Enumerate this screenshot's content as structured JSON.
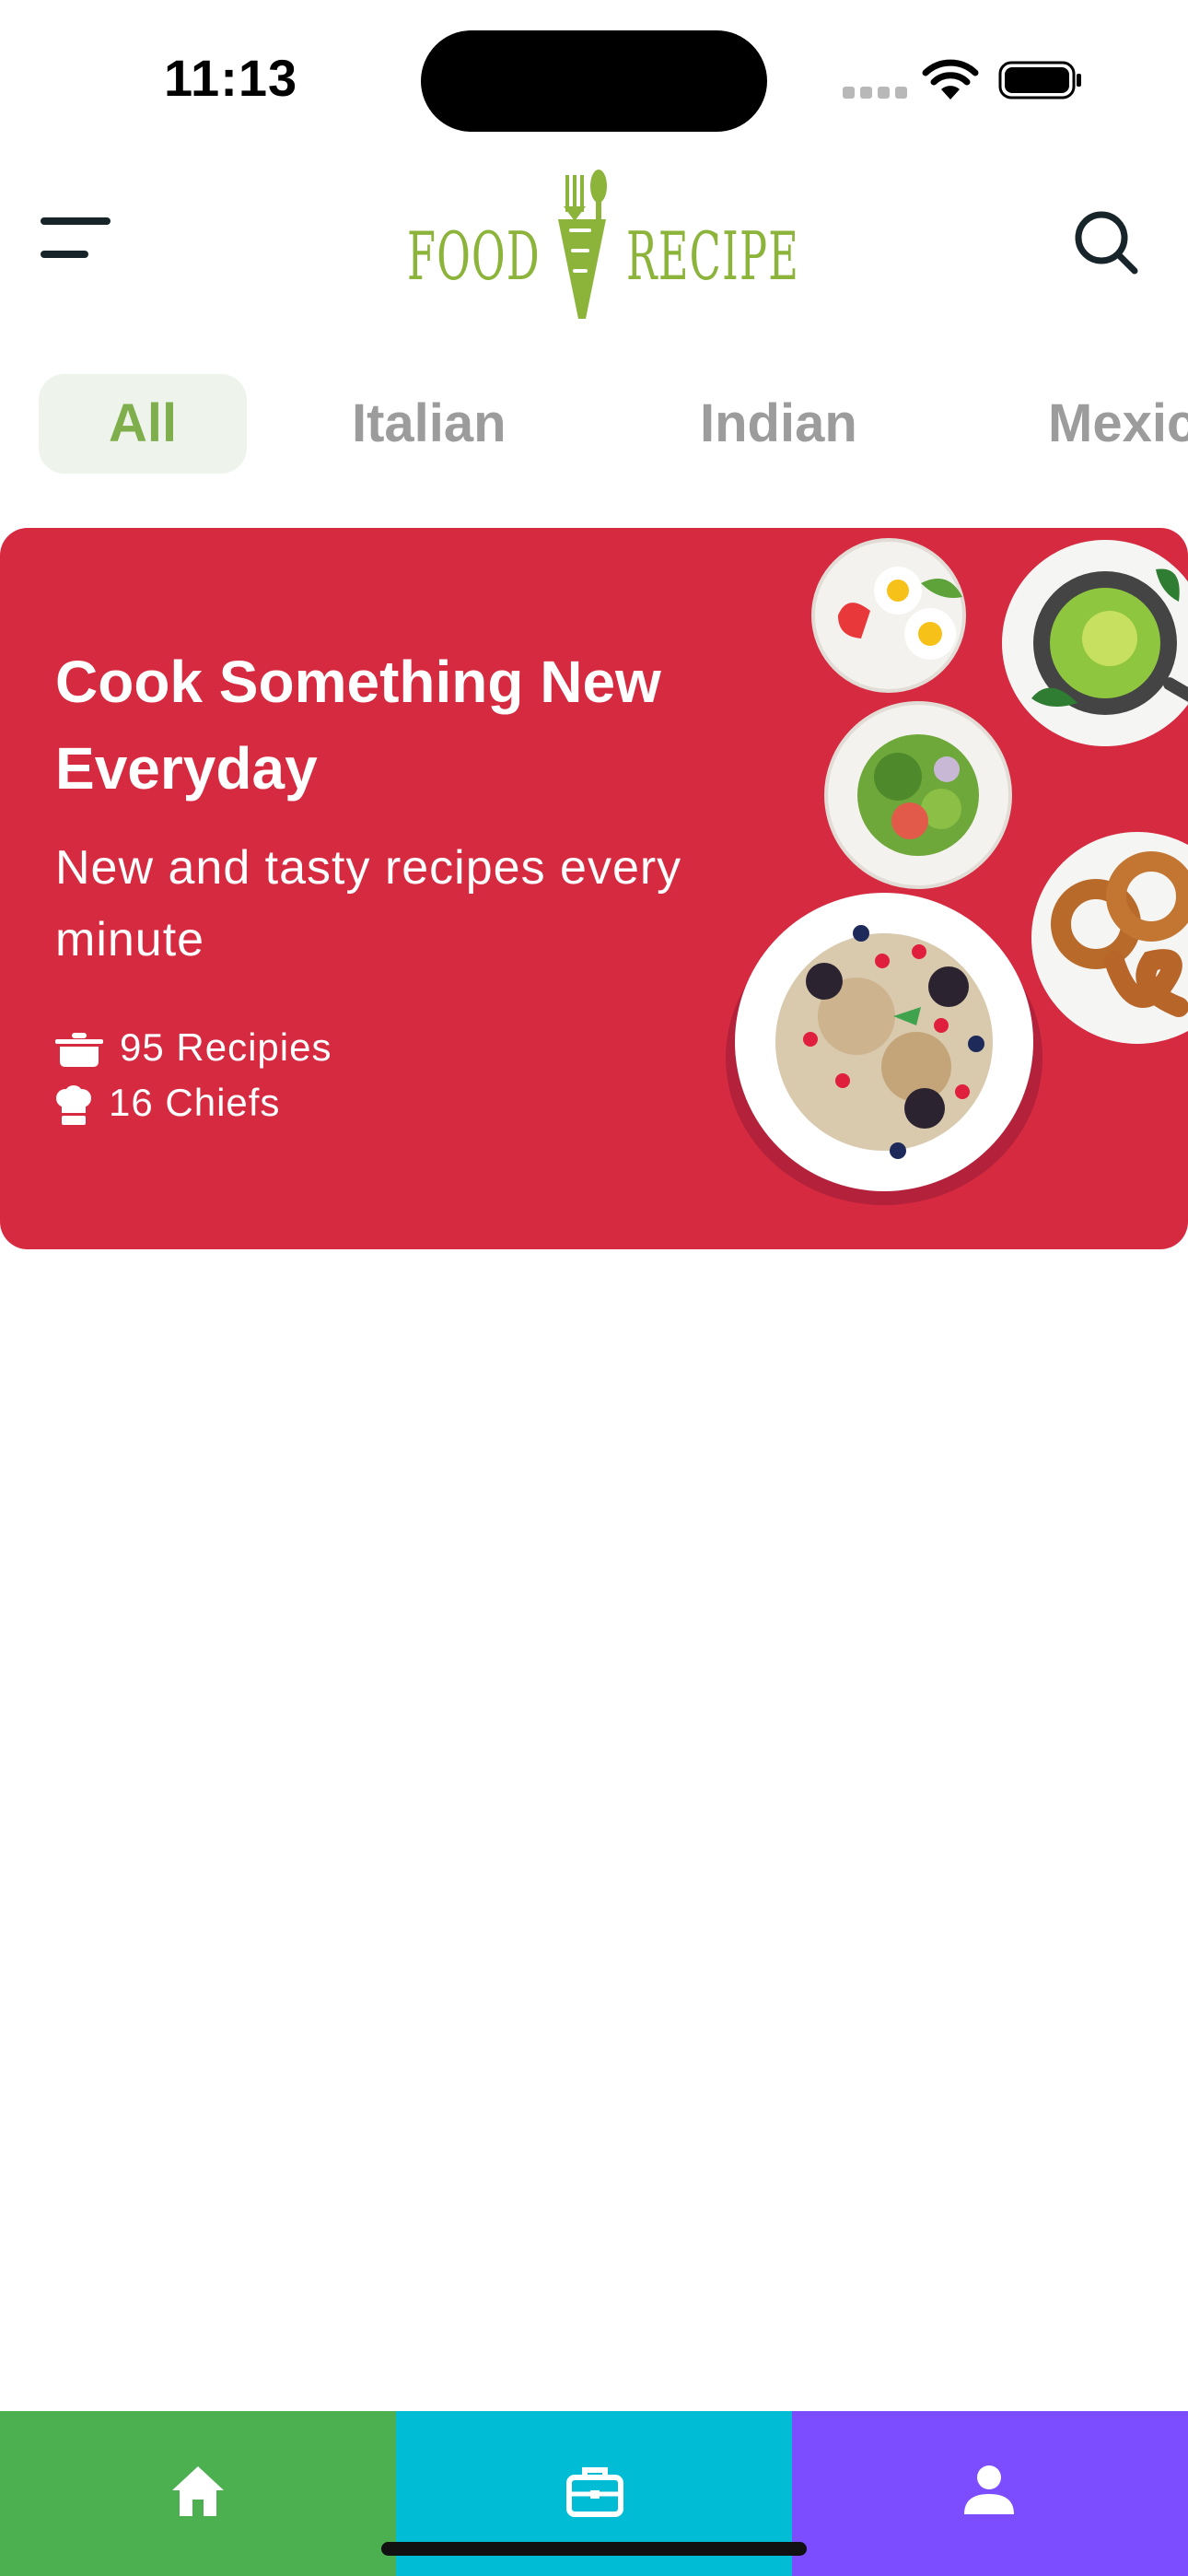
{
  "status_bar": {
    "time": "11:13",
    "icons": [
      "signal-dots-icon",
      "wifi-icon",
      "battery-icon"
    ]
  },
  "header": {
    "logo_word_1": "Food",
    "logo_word_2": "Recipe",
    "logo_color": "#8cb43a",
    "icons": [
      "menu-icon",
      "search-icon"
    ]
  },
  "categories": {
    "items": [
      "All",
      "Italian",
      "Indian",
      "Mexican"
    ],
    "active_index": 0,
    "active_color": "#7fae4c",
    "active_bg": "#eef3ec"
  },
  "banner": {
    "title": "Cook Something New Everyday",
    "subtitle": "New and tasty recipes every minute",
    "recipes_count": "95 Recipies",
    "chefs_count": "16 Chiefs",
    "background_color": "#d62a41"
  },
  "bottom_nav": {
    "items": [
      {
        "icon": "home-icon",
        "color": "#4caf50"
      },
      {
        "icon": "briefcase-icon",
        "color": "#00bcd4"
      },
      {
        "icon": "person-icon",
        "color": "#7c4dff"
      }
    ]
  }
}
